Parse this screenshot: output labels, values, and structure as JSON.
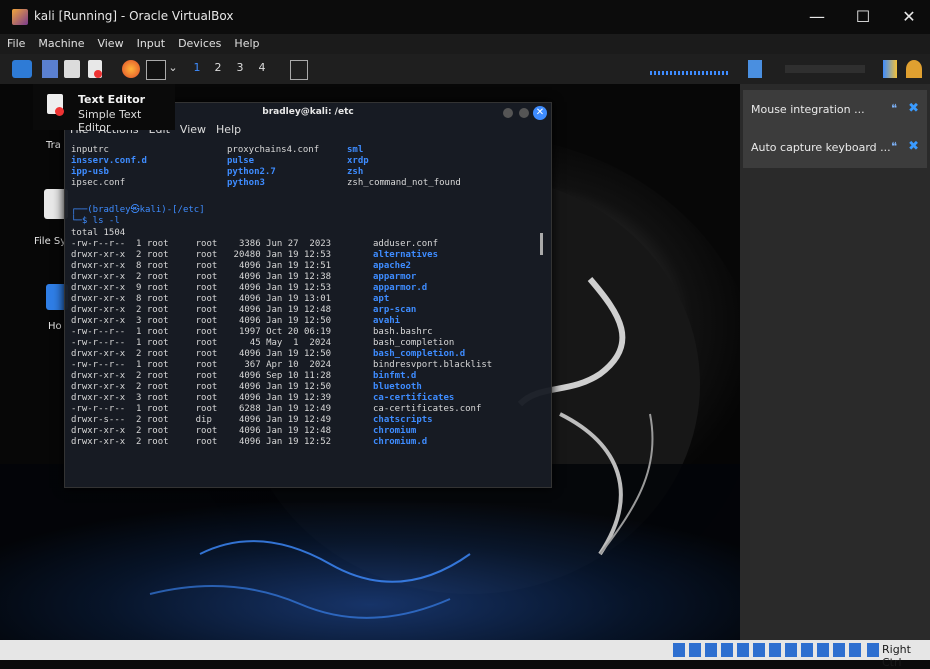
{
  "window": {
    "title": "kali [Running] - Oracle VirtualBox",
    "minimize": "—",
    "maximize": "☐",
    "close": "✕"
  },
  "menu": [
    "File",
    "Machine",
    "View",
    "Input",
    "Devices",
    "Help"
  ],
  "workspaces": [
    "1",
    "2",
    "3",
    "4"
  ],
  "tooltip": {
    "title": "Text Editor",
    "subtitle": "Simple Text Editor"
  },
  "desktop": {
    "items": [
      "Tra",
      "File Sy",
      "Ho"
    ]
  },
  "terminal": {
    "title": "bradley@kali: /etc",
    "menu": [
      "File",
      "Actions",
      "Edit",
      "View",
      "Help"
    ],
    "columns_rows": [
      [
        "inputrc",
        "proxychains4.conf",
        "sml",
        ""
      ],
      [
        "insserv.conf.d",
        "pulse",
        "xrdp",
        ""
      ],
      [
        "ipp-usb",
        "python2.7",
        "zsh",
        ""
      ],
      [
        "ipsec.conf",
        "python3",
        "zsh_command_not_found",
        ""
      ]
    ],
    "prompt_user": "┌──(bradley㉿kali)-[/etc]",
    "command": "└─$ ls -l",
    "total": "total 1504",
    "listing": [
      {
        "perm": "-rw-r--r--",
        "n": "1",
        "u": "root",
        "g": "root",
        "size": "3386",
        "date": "Jun 27  2023",
        "name": "adduser.conf",
        "dir": false
      },
      {
        "perm": "drwxr-xr-x",
        "n": "2",
        "u": "root",
        "g": "root",
        "size": "20480",
        "date": "Jan 19 12:53",
        "name": "alternatives",
        "dir": true
      },
      {
        "perm": "drwxr-xr-x",
        "n": "8",
        "u": "root",
        "g": "root",
        "size": "4096",
        "date": "Jan 19 12:51",
        "name": "apache2",
        "dir": true
      },
      {
        "perm": "drwxr-xr-x",
        "n": "2",
        "u": "root",
        "g": "root",
        "size": "4096",
        "date": "Jan 19 12:38",
        "name": "apparmor",
        "dir": true
      },
      {
        "perm": "drwxr-xr-x",
        "n": "9",
        "u": "root",
        "g": "root",
        "size": "4096",
        "date": "Jan 19 12:53",
        "name": "apparmor.d",
        "dir": true
      },
      {
        "perm": "drwxr-xr-x",
        "n": "8",
        "u": "root",
        "g": "root",
        "size": "4096",
        "date": "Jan 19 13:01",
        "name": "apt",
        "dir": true
      },
      {
        "perm": "drwxr-xr-x",
        "n": "2",
        "u": "root",
        "g": "root",
        "size": "4096",
        "date": "Jan 19 12:48",
        "name": "arp-scan",
        "dir": true
      },
      {
        "perm": "drwxr-xr-x",
        "n": "3",
        "u": "root",
        "g": "root",
        "size": "4096",
        "date": "Jan 19 12:50",
        "name": "avahi",
        "dir": true
      },
      {
        "perm": "-rw-r--r--",
        "n": "1",
        "u": "root",
        "g": "root",
        "size": "1997",
        "date": "Oct 20 06:19",
        "name": "bash.bashrc",
        "dir": false
      },
      {
        "perm": "-rw-r--r--",
        "n": "1",
        "u": "root",
        "g": "root",
        "size": "45",
        "date": "May  1  2024",
        "name": "bash_completion",
        "dir": false
      },
      {
        "perm": "drwxr-xr-x",
        "n": "2",
        "u": "root",
        "g": "root",
        "size": "4096",
        "date": "Jan 19 12:50",
        "name": "bash_completion.d",
        "dir": true
      },
      {
        "perm": "-rw-r--r--",
        "n": "1",
        "u": "root",
        "g": "root",
        "size": "367",
        "date": "Apr 10  2024",
        "name": "bindresvport.blacklist",
        "dir": false
      },
      {
        "perm": "drwxr-xr-x",
        "n": "2",
        "u": "root",
        "g": "root",
        "size": "4096",
        "date": "Sep 10 11:28",
        "name": "binfmt.d",
        "dir": true
      },
      {
        "perm": "drwxr-xr-x",
        "n": "2",
        "u": "root",
        "g": "root",
        "size": "4096",
        "date": "Jan 19 12:50",
        "name": "bluetooth",
        "dir": true
      },
      {
        "perm": "drwxr-xr-x",
        "n": "3",
        "u": "root",
        "g": "root",
        "size": "4096",
        "date": "Jan 19 12:39",
        "name": "ca-certificates",
        "dir": true
      },
      {
        "perm": "-rw-r--r--",
        "n": "1",
        "u": "root",
        "g": "root",
        "size": "6288",
        "date": "Jan 19 12:49",
        "name": "ca-certificates.conf",
        "dir": false
      },
      {
        "perm": "drwxr-s---",
        "n": "2",
        "u": "root",
        "g": "dip",
        "size": "4096",
        "date": "Jan 19 12:49",
        "name": "chatscripts",
        "dir": true
      },
      {
        "perm": "drwxr-xr-x",
        "n": "2",
        "u": "root",
        "g": "root",
        "size": "4096",
        "date": "Jan 19 12:48",
        "name": "chromium",
        "dir": true
      },
      {
        "perm": "drwxr-xr-x",
        "n": "2",
        "u": "root",
        "g": "root",
        "size": "4096",
        "date": "Jan 19 12:52",
        "name": "chromium.d",
        "dir": true
      }
    ]
  },
  "notifications": [
    {
      "text": "Mouse integration ..."
    },
    {
      "text": "Auto capture keyboard ..."
    }
  ],
  "status": {
    "host_key": "Right Ctrl"
  },
  "colors": {
    "dir_blue": "#3e8cff",
    "notif_close": "#3a9bff"
  }
}
